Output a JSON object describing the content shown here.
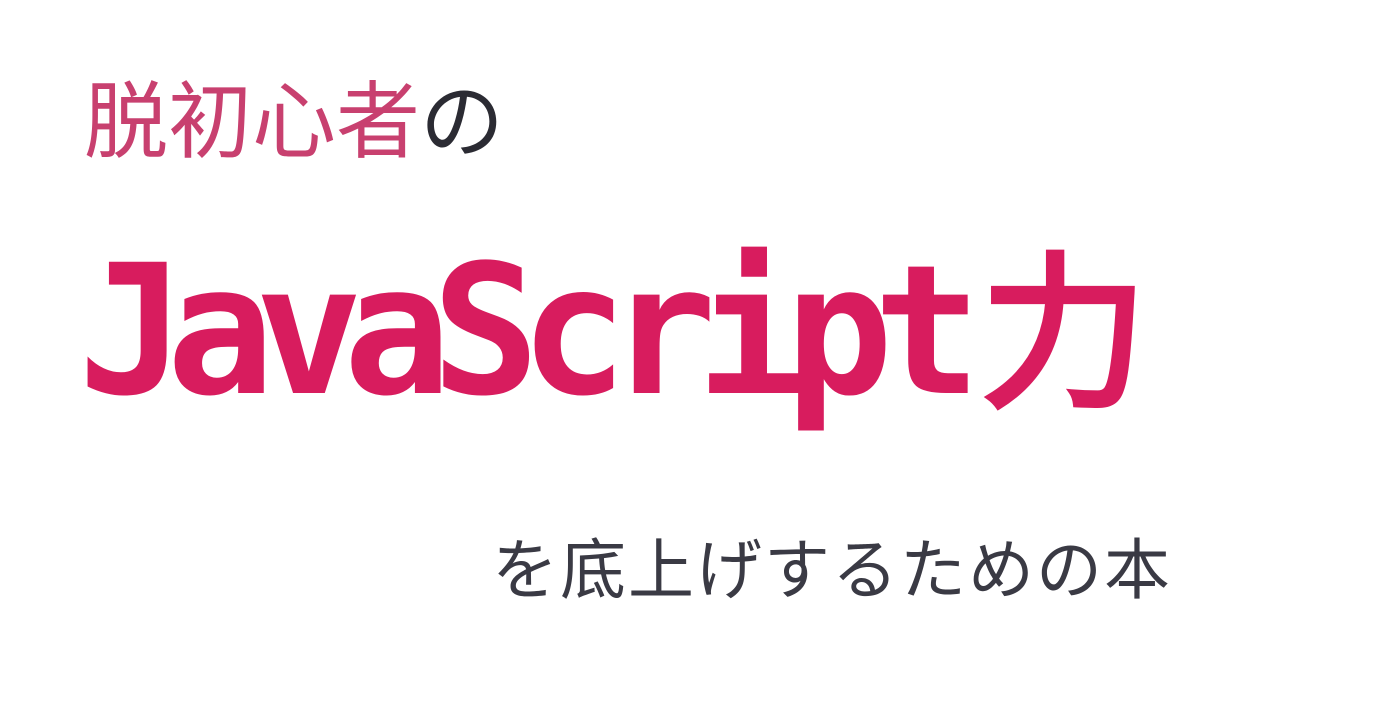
{
  "title": {
    "line1_accent": "脱初心者",
    "line1_rest": "の",
    "line2_latin": "JavaScript",
    "line2_kanji": "力",
    "line3": "を底上げするための本"
  },
  "colors": {
    "accent_soft": "#c8406f",
    "accent_strong": "#d81c5e",
    "text_dark": "#2b2b33",
    "text_gray": "#3a3a44",
    "background": "#ffffff"
  }
}
